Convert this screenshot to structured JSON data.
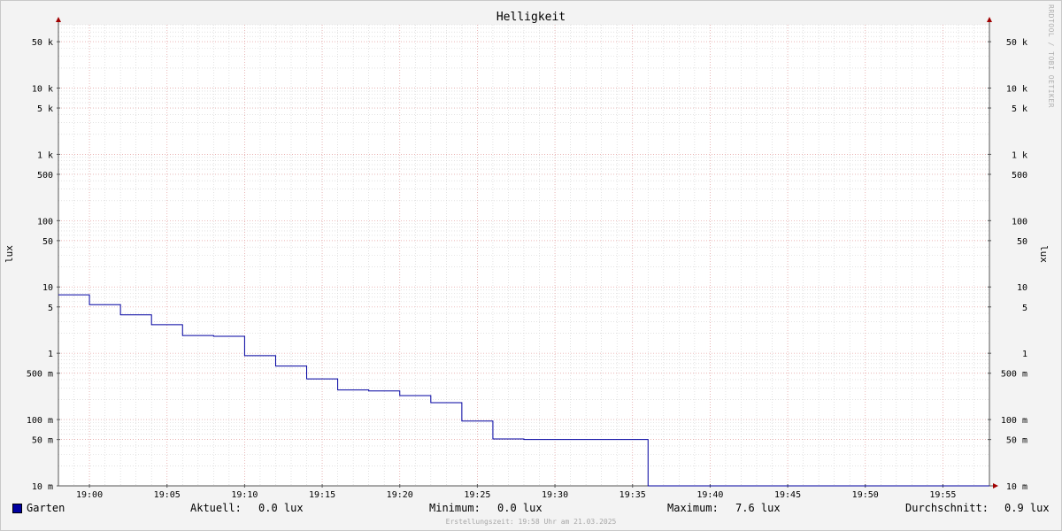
{
  "chart_data": {
    "type": "line",
    "title": "Helligkeit",
    "ylabel": "lux",
    "yscale": "log",
    "ylim": [
      10,
      90000
    ],
    "x_range": [
      "18:58",
      "19:58"
    ],
    "x_ticks": [
      "19:00",
      "19:05",
      "19:10",
      "19:15",
      "19:20",
      "19:25",
      "19:30",
      "19:35",
      "19:40",
      "19:45",
      "19:50",
      "19:55"
    ],
    "y_ticks": [
      {
        "v": 50000,
        "label": "50 k"
      },
      {
        "v": 10000,
        "label": "10 k"
      },
      {
        "v": 5000,
        "label": "5 k"
      },
      {
        "v": 1000,
        "label": "1 k"
      },
      {
        "v": 500,
        "label": "500"
      },
      {
        "v": 100,
        "label": "100"
      },
      {
        "v": 50,
        "label": "50"
      },
      {
        "v": 10,
        "label": "10"
      },
      {
        "v": 5,
        "label": "5"
      },
      {
        "v": 1,
        "label": "1"
      },
      {
        "v": 0.5,
        "label": "500 m"
      },
      {
        "v": 0.1,
        "label": "100 m"
      },
      {
        "v": 0.05,
        "label": "50 m"
      },
      {
        "v": 0.01,
        "label": "10 m"
      }
    ],
    "grid": true,
    "series": [
      {
        "name": "Garten",
        "color": "#0000a0",
        "step": true,
        "points": [
          [
            "18:58",
            7.6
          ],
          [
            "19:00",
            5.4
          ],
          [
            "19:02",
            3.8
          ],
          [
            "19:04",
            2.7
          ],
          [
            "19:06",
            1.85
          ],
          [
            "19:08",
            1.8
          ],
          [
            "19:10",
            0.92
          ],
          [
            "19:12",
            0.64
          ],
          [
            "19:14",
            0.41
          ],
          [
            "19:16",
            0.28
          ],
          [
            "19:18",
            0.27
          ],
          [
            "19:20",
            0.23
          ],
          [
            "19:22",
            0.18
          ],
          [
            "19:24",
            0.095
          ],
          [
            "19:26",
            0.051
          ],
          [
            "19:28",
            0.05
          ],
          [
            "19:36",
            0.0
          ],
          [
            "19:58",
            0.0
          ]
        ]
      }
    ]
  },
  "legend": {
    "series_name": "Garten",
    "current_label": "Aktuell:",
    "current_value": "0.0 lux",
    "min_label": "Minimum:",
    "min_value": "0.0 lux",
    "max_label": "Maximum:",
    "max_value": "7.6 lux",
    "avg_label": "Durchschnitt:",
    "avg_value": "0.9 lux"
  },
  "footer": "Erstellungszeit: 19:58 Uhr am 21.03.2025",
  "watermark": "RRDTOOL / TOBI OETIKER",
  "colors": {
    "series": "#0000a0",
    "minor_grid": "#d0d0d0",
    "major_grid": "#e8a0a0",
    "background": "#f3f3f3",
    "plot": "#ffffff",
    "arrow": "#a00000"
  }
}
